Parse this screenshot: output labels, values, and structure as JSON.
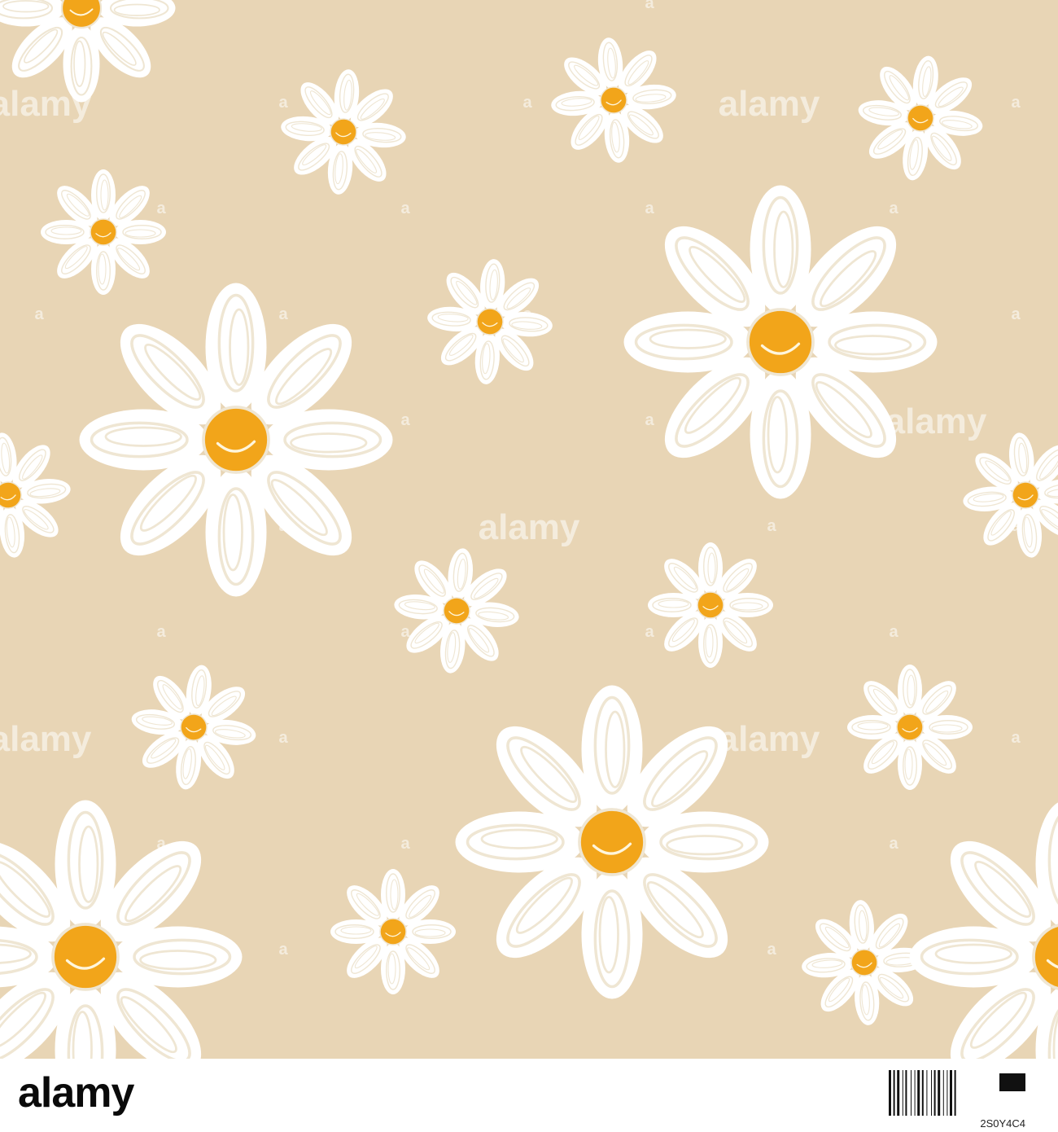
{
  "watermark": {
    "text": "alamy",
    "letter": "a"
  },
  "footer": {
    "logo": "alamy",
    "image_id": "2S0Y4C4"
  },
  "colors": {
    "background": "#e8d5b5",
    "petal": "#ffffff",
    "petal_stroke": "#efe6d3",
    "center": "#f2a51a",
    "center_highlight": "#fff6dc"
  },
  "icons": [
    "daisy-icon"
  ]
}
